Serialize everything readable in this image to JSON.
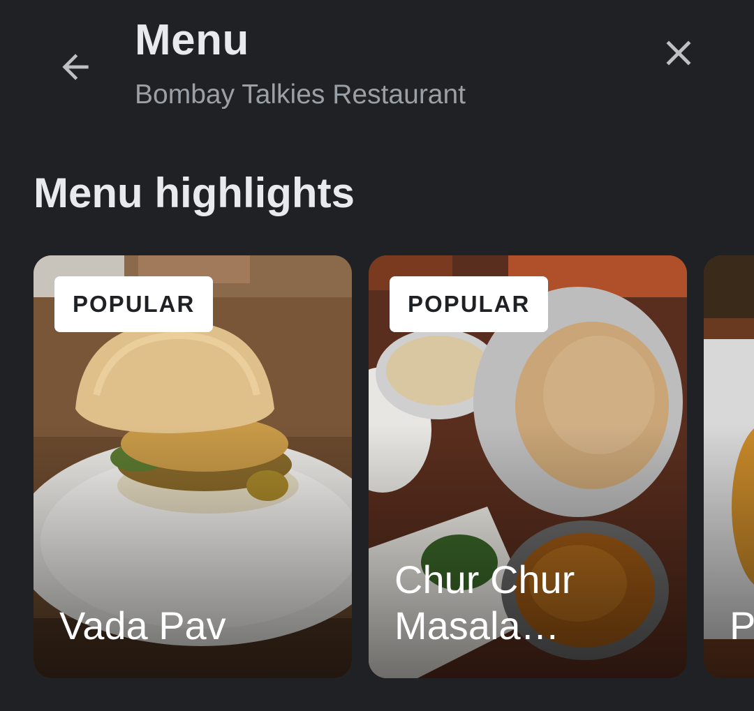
{
  "header": {
    "title": "Menu",
    "subtitle": "Bombay Talkies Restaurant",
    "back_icon": "arrow-left-icon",
    "close_icon": "close-icon"
  },
  "section": {
    "title": "Menu highlights"
  },
  "cards": [
    {
      "badge": "POPULAR",
      "name": "Vada Pav"
    },
    {
      "badge": "POPULAR",
      "name": "Chur Chur Masala…"
    },
    {
      "badge": "",
      "name": "P"
    }
  ],
  "colors": {
    "background": "#202124",
    "title": "#e8eaed",
    "subtitle": "#9aa0a6",
    "badge_bg": "#ffffff",
    "badge_text": "#202124"
  }
}
